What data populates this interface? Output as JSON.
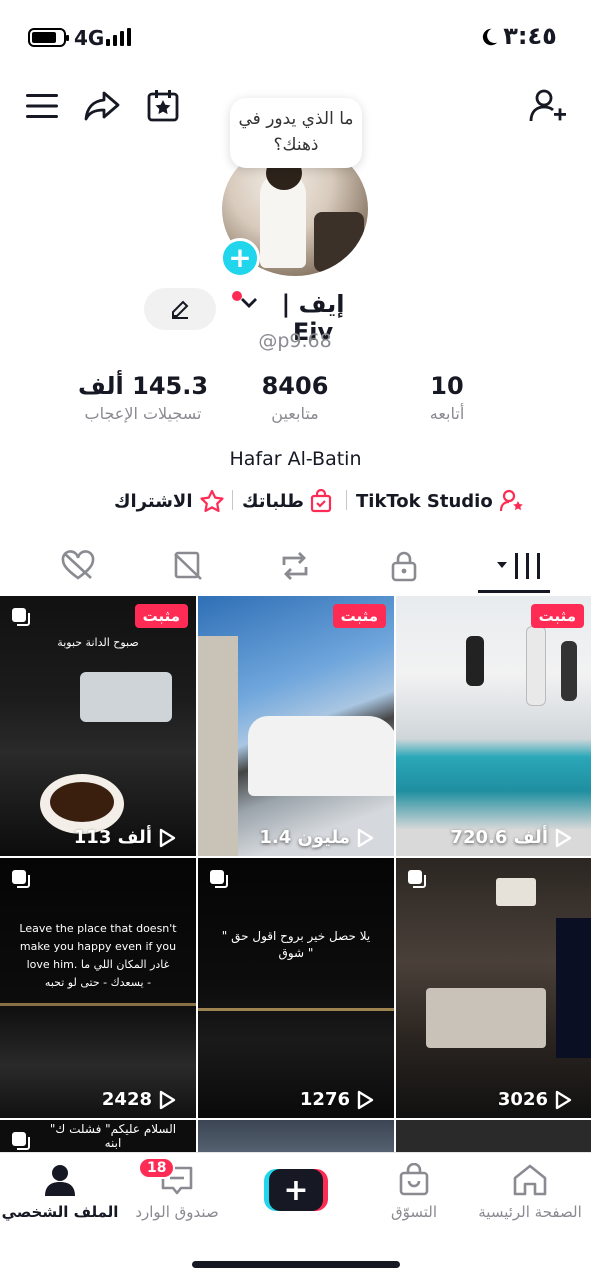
{
  "status_bar": {
    "network": "4G",
    "time": "٣:٤٥"
  },
  "profile": {
    "note_bubble": "ما الذي يدور في ذهنك؟",
    "display_name": "إيف | Eiv",
    "username": "@p9.68",
    "location": "Hafar Al-Batin"
  },
  "stats": [
    {
      "value": "10",
      "label": "أتابعه"
    },
    {
      "value": "8406",
      "label": "متابعين"
    },
    {
      "value": "145.3 ألف",
      "label": "تسجيلات الإعجاب"
    }
  ],
  "links": {
    "studio": "TikTok Studio",
    "orders": "طلباتك",
    "subscription": "الاشتراك"
  },
  "tabs": [
    "videos-grid",
    "private",
    "reposts",
    "favorites",
    "liked"
  ],
  "videos": [
    {
      "pinned_label": "مثبت",
      "views": "720.6 ألف",
      "overlay": ""
    },
    {
      "pinned_label": "مثبت",
      "views": "1.4 مليون",
      "overlay": ""
    },
    {
      "pinned_label": "مثبت",
      "views": "113 ألف",
      "overlay": "صبوح الدانة حبوبة"
    },
    {
      "pinned_label": "",
      "views": "3026",
      "overlay": ""
    },
    {
      "pinned_label": "",
      "views": "1276",
      "overlay": "\" يلا حصل خير بروح اقول حق شوق \""
    },
    {
      "pinned_label": "",
      "views": "2428",
      "overlay": "Leave the place that doesn't make you happy even if you love him. غادر المكان اللي ما يسعدك - حتى لو تحبه -"
    }
  ],
  "partial_row": {
    "left_overlay": "\"السلام عليكم\" فشلت ك ابنه"
  },
  "bottom_nav": {
    "home": "الصفحة الرئيسية",
    "shop": "التسوّق",
    "inbox": "صندوق الوارد",
    "inbox_badge": "18",
    "profile": "الملف الشخصي"
  },
  "colors": {
    "accent": "#fe2c55",
    "cyan": "#20d5ec",
    "text": "#161823",
    "muted": "#8a8b91"
  }
}
